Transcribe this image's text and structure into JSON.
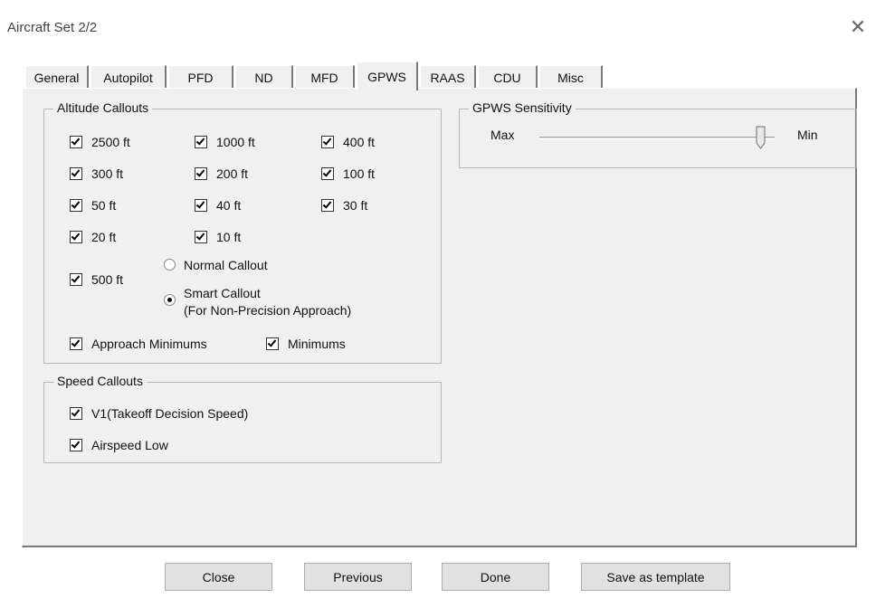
{
  "window": {
    "title": "Aircraft Set 2/2"
  },
  "tabs": [
    "General",
    "Autopilot",
    "PFD",
    "ND",
    "MFD",
    "GPWS",
    "RAAS",
    "CDU",
    "Misc"
  ],
  "active_tab": "GPWS",
  "altitude_callouts": {
    "title": "Altitude Callouts",
    "items": [
      {
        "label": "2500 ft",
        "checked": true
      },
      {
        "label": "1000 ft",
        "checked": true
      },
      {
        "label": "400 ft",
        "checked": true
      },
      {
        "label": "300 ft",
        "checked": true
      },
      {
        "label": "200 ft",
        "checked": true
      },
      {
        "label": "100 ft",
        "checked": true
      },
      {
        "label": "50 ft",
        "checked": true
      },
      {
        "label": "40 ft",
        "checked": true
      },
      {
        "label": "30 ft",
        "checked": true
      },
      {
        "label": "20 ft",
        "checked": true
      },
      {
        "label": "10 ft",
        "checked": true
      }
    ],
    "ft500": {
      "label": "500 ft",
      "checked": true
    },
    "normal_callout": {
      "label": "Normal Callout",
      "selected": false
    },
    "smart_callout": {
      "label_line1": "Smart Callout",
      "label_line2": "(For Non-Precision Approach)",
      "selected": true
    },
    "approach_minimums": {
      "label": "Approach Minimums",
      "checked": true
    },
    "minimums": {
      "label": "Minimums",
      "checked": true
    }
  },
  "speed_callouts": {
    "title": "Speed Callouts",
    "v1": {
      "label": "V1(Takeoff Decision Speed)",
      "checked": true
    },
    "airspeed_low": {
      "label": "Airspeed Low",
      "checked": true
    }
  },
  "gpws_sensitivity": {
    "title": "GPWS Sensitivity",
    "min_label": "Max",
    "max_label": "Min",
    "value_fraction": 0.94
  },
  "buttons": {
    "close": "Close",
    "previous": "Previous",
    "done": "Done",
    "save_template": "Save as template"
  }
}
